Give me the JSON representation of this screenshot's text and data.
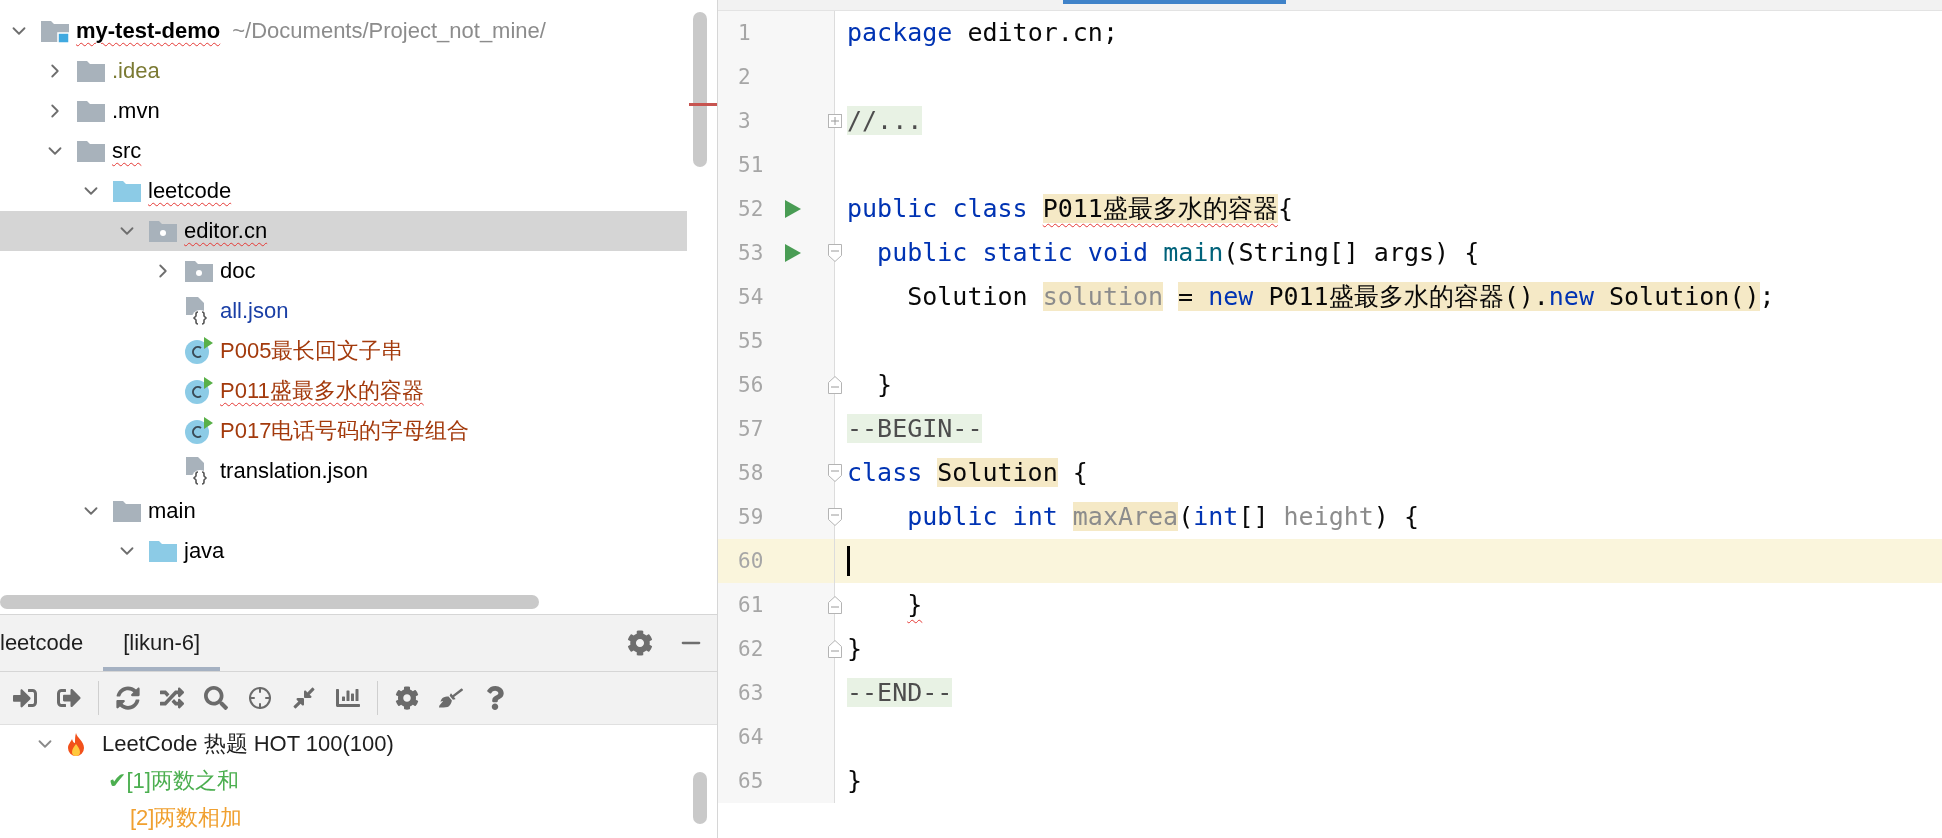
{
  "project_tree": {
    "items": [
      {
        "label": "my-test-demo",
        "path": "~/Documents/Project_not_mine/",
        "kind": "project",
        "expanded": true,
        "selected": false,
        "typo": true,
        "color": "#000000",
        "children": [
          {
            "label": ".idea",
            "kind": "folder",
            "expanded": false,
            "selected": false,
            "typo": false,
            "color": "#7b7a33"
          },
          {
            "label": ".mvn",
            "kind": "folder",
            "expanded": false,
            "selected": false,
            "typo": false,
            "color": "#000000"
          },
          {
            "label": "src",
            "kind": "folder",
            "expanded": true,
            "selected": false,
            "typo": true,
            "color": "#000000",
            "children": [
              {
                "label": "leetcode",
                "kind": "source-folder",
                "expanded": true,
                "selected": false,
                "typo": true,
                "color": "#000000",
                "children": [
                  {
                    "label": "editor.cn",
                    "kind": "package",
                    "expanded": true,
                    "selected": true,
                    "typo": true,
                    "color": "#000000",
                    "children": [
                      {
                        "label": "doc",
                        "kind": "package",
                        "expanded": false,
                        "selected": false,
                        "typo": false,
                        "color": "#000000"
                      },
                      {
                        "label": "all.json",
                        "kind": "json",
                        "selected": false,
                        "typo": false,
                        "color": "#1a3fa6"
                      },
                      {
                        "label": "P005最长回文子串",
                        "kind": "class",
                        "selected": false,
                        "typo": false,
                        "color": "#a33a0c"
                      },
                      {
                        "label": "P011盛最多水的容器",
                        "kind": "class",
                        "selected": false,
                        "typo": true,
                        "color": "#a33a0c"
                      },
                      {
                        "label": "P017电话号码的字母组合",
                        "kind": "class",
                        "selected": false,
                        "typo": false,
                        "color": "#a33a0c"
                      },
                      {
                        "label": "translation.json",
                        "kind": "json",
                        "selected": false,
                        "typo": false,
                        "color": "#000000"
                      }
                    ]
                  }
                ]
              },
              {
                "label": "main",
                "kind": "folder",
                "expanded": true,
                "selected": false,
                "typo": false,
                "color": "#000000",
                "children": [
                  {
                    "label": "java",
                    "kind": "source-folder",
                    "expanded": true,
                    "selected": false,
                    "typo": false,
                    "color": "#000000"
                  }
                ]
              }
            ]
          }
        ]
      }
    ]
  },
  "tool_window": {
    "tabs": [
      {
        "label": "leetcode",
        "selected": false
      },
      {
        "label": "[likun-6]",
        "selected": true
      }
    ],
    "problems": [
      {
        "label": "LeetCode 热题 HOT 100(100)",
        "expanded": true,
        "children": [
          {
            "label": "✔[1]两数之和",
            "solved": true
          },
          {
            "label": "[2]两数相加",
            "solved": false
          }
        ]
      }
    ]
  },
  "editor": {
    "lines": [
      {
        "number": "1",
        "current": false,
        "tokens": [
          {
            "text": "package",
            "kind": "keyword"
          },
          {
            "text": " editor.cn;",
            "kind": "plain"
          }
        ]
      },
      {
        "number": "2",
        "current": false
      },
      {
        "number": "3",
        "current": false,
        "fold_collapsed": true,
        "tokens": [
          {
            "text": "//...",
            "kind": "folded"
          }
        ]
      },
      {
        "number": "51",
        "current": false
      },
      {
        "number": "52",
        "current": false,
        "run": true,
        "tokens": [
          {
            "text": "public",
            "kind": "keyword"
          },
          {
            "text": " class ",
            "kind": "keyword"
          },
          {
            "text": "P011盛最多水的容器",
            "kind": "plain",
            "hl": true,
            "typo": true
          },
          {
            "text": "{",
            "kind": "plain"
          }
        ]
      },
      {
        "number": "53",
        "current": false,
        "run": true,
        "fold_start": true,
        "tokens": [
          {
            "text": "  public",
            "kind": "keyword"
          },
          {
            "text": " static",
            "kind": "keyword"
          },
          {
            "text": " void",
            "kind": "keyword"
          },
          {
            "text": " main",
            "kind": "method"
          },
          {
            "text": "(String[] args) {",
            "kind": "plain"
          }
        ]
      },
      {
        "number": "54",
        "current": false,
        "tokens": [
          {
            "text": "    Solution ",
            "kind": "plain"
          },
          {
            "text": "solution",
            "kind": "unused",
            "hl": true
          },
          {
            "text": "= ",
            "kind": "plain",
            "hl": true,
            "gap": true
          },
          {
            "text": "new",
            "kind": "keyword",
            "hl": true
          },
          {
            "text": " P011盛最多水的容器().",
            "kind": "plain",
            "hl": true
          },
          {
            "text": "new",
            "kind": "keyword",
            "hl": true
          },
          {
            "text": " Solution()",
            "kind": "plain",
            "hl": true
          },
          {
            "text": ";",
            "kind": "plain"
          }
        ]
      },
      {
        "number": "55",
        "current": false
      },
      {
        "number": "56",
        "current": false,
        "fold_end": true,
        "tokens": [
          {
            "text": "  }",
            "kind": "plain"
          }
        ]
      },
      {
        "number": "57",
        "current": false,
        "tokens": [
          {
            "text": "--BEGIN--",
            "kind": "folded"
          }
        ]
      },
      {
        "number": "58",
        "current": false,
        "fold_start": true,
        "tokens": [
          {
            "text": "class ",
            "kind": "keyword"
          },
          {
            "text": "Solution",
            "kind": "plain",
            "hl": true
          },
          {
            "text": " {",
            "kind": "plain"
          }
        ]
      },
      {
        "number": "59",
        "current": false,
        "fold_start": true,
        "tokens": [
          {
            "text": "    public",
            "kind": "keyword"
          },
          {
            "text": " int ",
            "kind": "keyword"
          },
          {
            "text": "maxArea",
            "kind": "unused",
            "hl": true
          },
          {
            "text": "(",
            "kind": "plain"
          },
          {
            "text": "int",
            "kind": "keyword"
          },
          {
            "text": "[] ",
            "kind": "plain"
          },
          {
            "text": "height",
            "kind": "unused"
          },
          {
            "text": ") {",
            "kind": "plain"
          }
        ]
      },
      {
        "number": "60",
        "current": true
      },
      {
        "number": "61",
        "current": false,
        "fold_end": true,
        "tokens": [
          {
            "text": "    }",
            "kind": "plain",
            "typo": true
          }
        ]
      },
      {
        "number": "62",
        "current": false,
        "fold_end": true,
        "tokens": [
          {
            "text": "}",
            "kind": "plain"
          }
        ]
      },
      {
        "number": "63",
        "current": false,
        "tokens": [
          {
            "text": "--END--",
            "kind": "folded"
          }
        ]
      },
      {
        "number": "64",
        "current": false
      },
      {
        "number": "65",
        "current": false,
        "tokens": [
          {
            "text": "}",
            "kind": "plain"
          }
        ]
      }
    ]
  }
}
